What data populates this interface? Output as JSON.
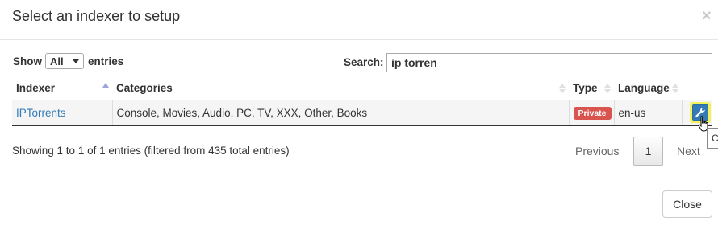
{
  "modal": {
    "title": "Select an indexer to setup",
    "close_glyph": "×"
  },
  "length": {
    "prefix": "Show",
    "selected": "All",
    "suffix": "entries"
  },
  "search": {
    "label": "Search:",
    "value": "ip torren"
  },
  "table": {
    "headers": [
      "Indexer",
      "Categories",
      "Type",
      "Language"
    ],
    "rows": [
      {
        "indexer": "IPTorrents",
        "categories": "Console, Movies, Audio, PC, TV, XXX, Other, Books",
        "type": "Private",
        "language": "en-us"
      }
    ]
  },
  "info": "Showing 1 to 1 of 1 entries (filtered from 435 total entries)",
  "pagination": {
    "previous": "Previous",
    "current": "1",
    "next": "Next"
  },
  "tooltip_text": "C",
  "footer": {
    "close_label": "Close"
  },
  "colors": {
    "link": "#337ab7",
    "badge_private": "#d9534f",
    "config_button": "#337ab7",
    "highlight": "#f2f25a"
  },
  "icons": {
    "config": "wrench-icon",
    "cursor": "hand-pointer-icon"
  }
}
